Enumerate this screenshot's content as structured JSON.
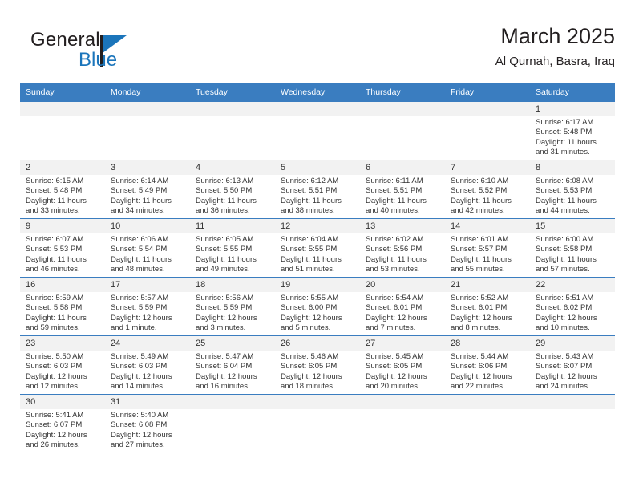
{
  "brand": {
    "name_top": "General",
    "name_bottom": "Blue",
    "accent_color": "#1b75bb"
  },
  "header": {
    "title": "March 2025",
    "subtitle": "Al Qurnah, Basra, Iraq"
  },
  "calendar": {
    "header_bg": "#3a7dc0",
    "daynum_bg": "#f2f2f2",
    "weekdays": [
      "Sunday",
      "Monday",
      "Tuesday",
      "Wednesday",
      "Thursday",
      "Friday",
      "Saturday"
    ],
    "weeks": [
      [
        {
          "day": "",
          "empty": true
        },
        {
          "day": "",
          "empty": true
        },
        {
          "day": "",
          "empty": true
        },
        {
          "day": "",
          "empty": true
        },
        {
          "day": "",
          "empty": true
        },
        {
          "day": "",
          "empty": true
        },
        {
          "day": "1",
          "sunrise": "Sunrise: 6:17 AM",
          "sunset": "Sunset: 5:48 PM",
          "daylight1": "Daylight: 11 hours",
          "daylight2": "and 31 minutes."
        }
      ],
      [
        {
          "day": "2",
          "sunrise": "Sunrise: 6:15 AM",
          "sunset": "Sunset: 5:48 PM",
          "daylight1": "Daylight: 11 hours",
          "daylight2": "and 33 minutes."
        },
        {
          "day": "3",
          "sunrise": "Sunrise: 6:14 AM",
          "sunset": "Sunset: 5:49 PM",
          "daylight1": "Daylight: 11 hours",
          "daylight2": "and 34 minutes."
        },
        {
          "day": "4",
          "sunrise": "Sunrise: 6:13 AM",
          "sunset": "Sunset: 5:50 PM",
          "daylight1": "Daylight: 11 hours",
          "daylight2": "and 36 minutes."
        },
        {
          "day": "5",
          "sunrise": "Sunrise: 6:12 AM",
          "sunset": "Sunset: 5:51 PM",
          "daylight1": "Daylight: 11 hours",
          "daylight2": "and 38 minutes."
        },
        {
          "day": "6",
          "sunrise": "Sunrise: 6:11 AM",
          "sunset": "Sunset: 5:51 PM",
          "daylight1": "Daylight: 11 hours",
          "daylight2": "and 40 minutes."
        },
        {
          "day": "7",
          "sunrise": "Sunrise: 6:10 AM",
          "sunset": "Sunset: 5:52 PM",
          "daylight1": "Daylight: 11 hours",
          "daylight2": "and 42 minutes."
        },
        {
          "day": "8",
          "sunrise": "Sunrise: 6:08 AM",
          "sunset": "Sunset: 5:53 PM",
          "daylight1": "Daylight: 11 hours",
          "daylight2": "and 44 minutes."
        }
      ],
      [
        {
          "day": "9",
          "sunrise": "Sunrise: 6:07 AM",
          "sunset": "Sunset: 5:53 PM",
          "daylight1": "Daylight: 11 hours",
          "daylight2": "and 46 minutes."
        },
        {
          "day": "10",
          "sunrise": "Sunrise: 6:06 AM",
          "sunset": "Sunset: 5:54 PM",
          "daylight1": "Daylight: 11 hours",
          "daylight2": "and 48 minutes."
        },
        {
          "day": "11",
          "sunrise": "Sunrise: 6:05 AM",
          "sunset": "Sunset: 5:55 PM",
          "daylight1": "Daylight: 11 hours",
          "daylight2": "and 49 minutes."
        },
        {
          "day": "12",
          "sunrise": "Sunrise: 6:04 AM",
          "sunset": "Sunset: 5:55 PM",
          "daylight1": "Daylight: 11 hours",
          "daylight2": "and 51 minutes."
        },
        {
          "day": "13",
          "sunrise": "Sunrise: 6:02 AM",
          "sunset": "Sunset: 5:56 PM",
          "daylight1": "Daylight: 11 hours",
          "daylight2": "and 53 minutes."
        },
        {
          "day": "14",
          "sunrise": "Sunrise: 6:01 AM",
          "sunset": "Sunset: 5:57 PM",
          "daylight1": "Daylight: 11 hours",
          "daylight2": "and 55 minutes."
        },
        {
          "day": "15",
          "sunrise": "Sunrise: 6:00 AM",
          "sunset": "Sunset: 5:58 PM",
          "daylight1": "Daylight: 11 hours",
          "daylight2": "and 57 minutes."
        }
      ],
      [
        {
          "day": "16",
          "sunrise": "Sunrise: 5:59 AM",
          "sunset": "Sunset: 5:58 PM",
          "daylight1": "Daylight: 11 hours",
          "daylight2": "and 59 minutes."
        },
        {
          "day": "17",
          "sunrise": "Sunrise: 5:57 AM",
          "sunset": "Sunset: 5:59 PM",
          "daylight1": "Daylight: 12 hours",
          "daylight2": "and 1 minute."
        },
        {
          "day": "18",
          "sunrise": "Sunrise: 5:56 AM",
          "sunset": "Sunset: 5:59 PM",
          "daylight1": "Daylight: 12 hours",
          "daylight2": "and 3 minutes."
        },
        {
          "day": "19",
          "sunrise": "Sunrise: 5:55 AM",
          "sunset": "Sunset: 6:00 PM",
          "daylight1": "Daylight: 12 hours",
          "daylight2": "and 5 minutes."
        },
        {
          "day": "20",
          "sunrise": "Sunrise: 5:54 AM",
          "sunset": "Sunset: 6:01 PM",
          "daylight1": "Daylight: 12 hours",
          "daylight2": "and 7 minutes."
        },
        {
          "day": "21",
          "sunrise": "Sunrise: 5:52 AM",
          "sunset": "Sunset: 6:01 PM",
          "daylight1": "Daylight: 12 hours",
          "daylight2": "and 8 minutes."
        },
        {
          "day": "22",
          "sunrise": "Sunrise: 5:51 AM",
          "sunset": "Sunset: 6:02 PM",
          "daylight1": "Daylight: 12 hours",
          "daylight2": "and 10 minutes."
        }
      ],
      [
        {
          "day": "23",
          "sunrise": "Sunrise: 5:50 AM",
          "sunset": "Sunset: 6:03 PM",
          "daylight1": "Daylight: 12 hours",
          "daylight2": "and 12 minutes."
        },
        {
          "day": "24",
          "sunrise": "Sunrise: 5:49 AM",
          "sunset": "Sunset: 6:03 PM",
          "daylight1": "Daylight: 12 hours",
          "daylight2": "and 14 minutes."
        },
        {
          "day": "25",
          "sunrise": "Sunrise: 5:47 AM",
          "sunset": "Sunset: 6:04 PM",
          "daylight1": "Daylight: 12 hours",
          "daylight2": "and 16 minutes."
        },
        {
          "day": "26",
          "sunrise": "Sunrise: 5:46 AM",
          "sunset": "Sunset: 6:05 PM",
          "daylight1": "Daylight: 12 hours",
          "daylight2": "and 18 minutes."
        },
        {
          "day": "27",
          "sunrise": "Sunrise: 5:45 AM",
          "sunset": "Sunset: 6:05 PM",
          "daylight1": "Daylight: 12 hours",
          "daylight2": "and 20 minutes."
        },
        {
          "day": "28",
          "sunrise": "Sunrise: 5:44 AM",
          "sunset": "Sunset: 6:06 PM",
          "daylight1": "Daylight: 12 hours",
          "daylight2": "and 22 minutes."
        },
        {
          "day": "29",
          "sunrise": "Sunrise: 5:43 AM",
          "sunset": "Sunset: 6:07 PM",
          "daylight1": "Daylight: 12 hours",
          "daylight2": "and 24 minutes."
        }
      ],
      [
        {
          "day": "30",
          "sunrise": "Sunrise: 5:41 AM",
          "sunset": "Sunset: 6:07 PM",
          "daylight1": "Daylight: 12 hours",
          "daylight2": "and 26 minutes."
        },
        {
          "day": "31",
          "sunrise": "Sunrise: 5:40 AM",
          "sunset": "Sunset: 6:08 PM",
          "daylight1": "Daylight: 12 hours",
          "daylight2": "and 27 minutes."
        },
        {
          "day": "",
          "empty": true
        },
        {
          "day": "",
          "empty": true
        },
        {
          "day": "",
          "empty": true
        },
        {
          "day": "",
          "empty": true
        },
        {
          "day": "",
          "empty": true
        }
      ]
    ]
  }
}
